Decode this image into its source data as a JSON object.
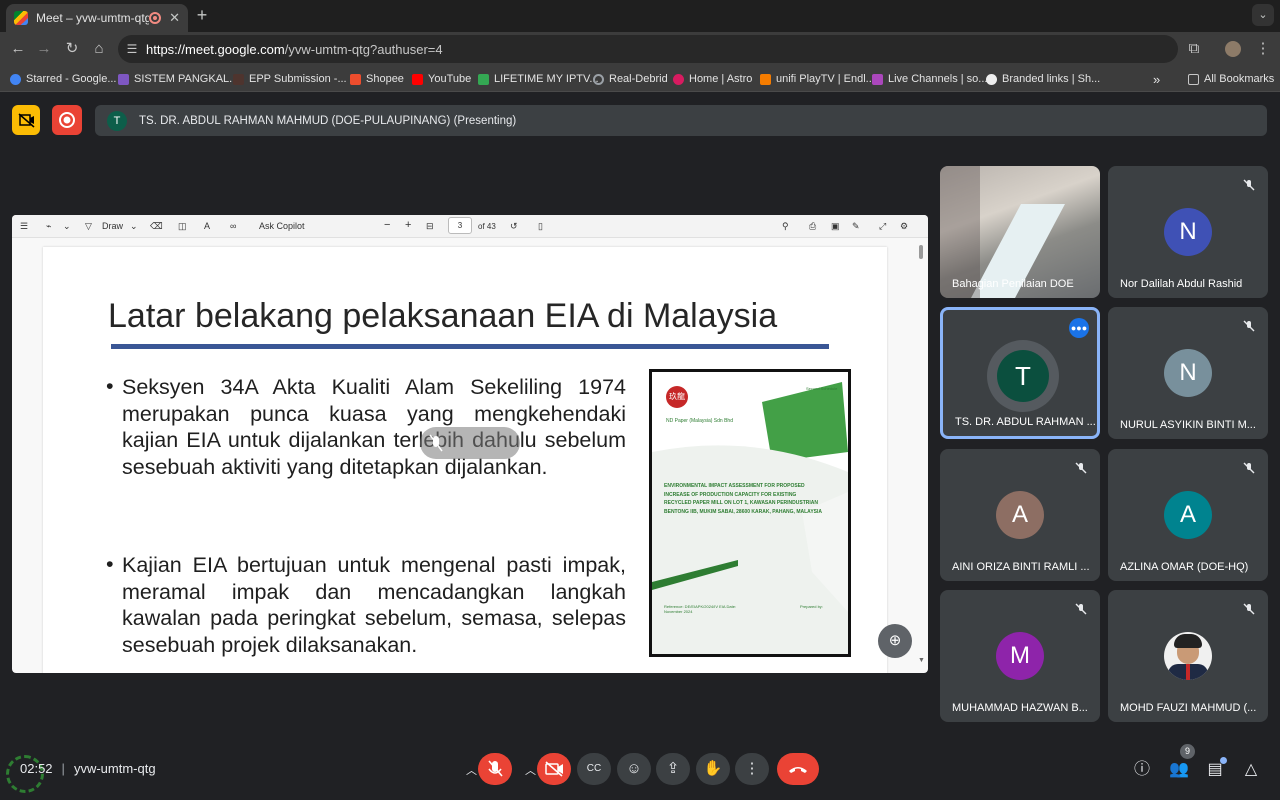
{
  "browser": {
    "tab_title": "Meet – yvw-umtm-qtg",
    "url_domain": "https://meet.google.com",
    "url_path": "/yvw-umtm-qtg?authuser=4",
    "bookmarks": [
      "Starred - Google...",
      "SISTEM PANGKAL...",
      "EPP Submission -...",
      "Shopee",
      "YouTube",
      "LIFETIME MY IPTV...",
      "Real-Debrid",
      "Home | Astro",
      "unifi PlayTV | Endl...",
      "Live Channels | so...",
      "Branded links | Sh..."
    ],
    "all_bookmarks": "All Bookmarks",
    "overflow": "»"
  },
  "presenting": {
    "avatar_letter": "T",
    "label": "TS. DR. ABDUL RAHMAN MAHMUD (DOE-PULAUPINANG) (Presenting)"
  },
  "pdf_viewer": {
    "draw_label": "Draw",
    "copilot_label": "Ask Copilot",
    "page_number": "3",
    "page_total": "of 43"
  },
  "slide": {
    "title": "Latar belakang pelaksanaan EIA di Malaysia",
    "bullets": [
      "Seksyen 34A Akta Kualiti Alam Sekeliling 1974 merupakan punca kuasa yang mengkehendaki kajian EIA untuk dijalankan terlebih dahulu sebelum sesebuah aktiviti yang ditetapkan dijalankan.",
      "Kajian EIA bertujuan untuk mengenal pasti impak, meramal impak dan mencadangkan langkah kawalan pada peringkat sebelum, semasa, selepas sesebuah projek dilaksanakan."
    ],
    "cover": {
      "logo_text": "玖龍",
      "company": "ND Paper (Malaysia) Sdn Bhd",
      "badge": "Second Schedule",
      "title": "ENVIRONMENTAL IMPACT ASSESSMENT FOR PROPOSED INCREASE OF PRODUCTION CAPACITY FOR EXISTING RECYCLED PAPER MILL ON LOT 1, KAWASAN PERINDUSTRIAN BENTONG IIB, MUKIM SABAI, 28600 KARAK, PAHANG, MALAYSIA",
      "reference": "Reference: DE/EIAPK/2024/IV EIA Date: November 2024",
      "prepared_by": "Prepared by:"
    }
  },
  "participants": [
    {
      "name": "Bahagian Penilaian DOE",
      "type": "video"
    },
    {
      "name": "Nor Dalilah Abdul Rashid",
      "letter": "N",
      "color": "#3f51b5",
      "muted": true
    },
    {
      "name": "TS. DR. ABDUL RAHMAN ...",
      "letter": "T",
      "color": "#0b4f3e",
      "speaking": true
    },
    {
      "name": "NURUL ASYIKIN BINTI M...",
      "letter": "N",
      "color": "#78909c",
      "muted": true
    },
    {
      "name": "AINI ORIZA BINTI RAMLI ...",
      "letter": "A",
      "color": "#8d6e63",
      "muted": true
    },
    {
      "name": "AZLINA OMAR (DOE-HQ)",
      "letter": "A",
      "color": "#00838f",
      "muted": true
    },
    {
      "name": "MUHAMMAD HAZWAN B...",
      "letter": "M",
      "color": "#8e24aa",
      "muted": true
    },
    {
      "name": "MOHD FAUZI MAHMUD (...",
      "type": "photo",
      "muted": true
    }
  ],
  "bottom_bar": {
    "time": "02:52",
    "meeting_code": "yvw-umtm-qtg",
    "participant_count": "9"
  },
  "icons": {
    "mic_off": "mic-off-icon",
    "cam_off": "videocam-off-icon",
    "captions": "captions-icon",
    "emoji": "emoji-icon",
    "present": "present-icon",
    "hand": "raise-hand-icon",
    "more": "more-vert-icon",
    "leave": "call-end-icon",
    "info": "info-icon",
    "people": "people-icon",
    "chat": "chat-icon",
    "activities": "activities-icon"
  },
  "colors": {
    "meet_bg": "#202124",
    "leave_red": "#ea4335",
    "speaking_blue": "#1a73e8",
    "slide_rule": "#3a5695"
  }
}
